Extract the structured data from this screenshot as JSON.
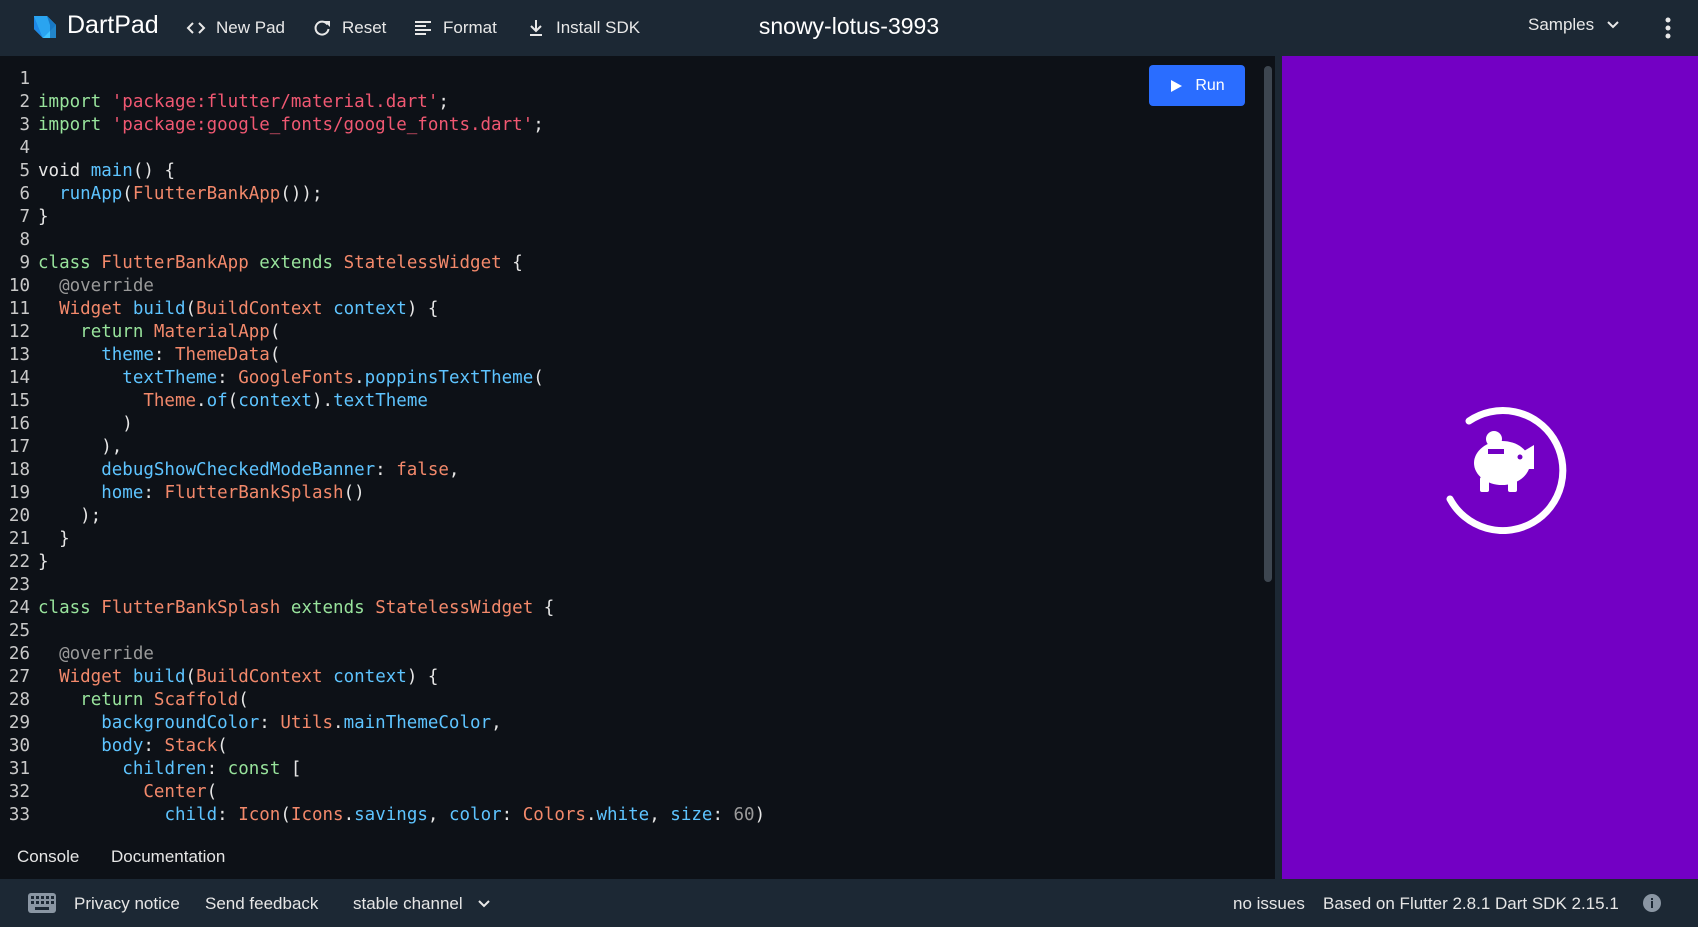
{
  "header": {
    "brand": "DartPad",
    "new_pad": "New Pad",
    "reset": "Reset",
    "format": "Format",
    "install_sdk": "Install SDK",
    "pad_name": "snowy-lotus-3993",
    "samples": "Samples"
  },
  "editor": {
    "run_label": "Run",
    "line_numbers": [
      "1",
      "2",
      "3",
      "4",
      "5",
      "6",
      "7",
      "8",
      "9",
      "10",
      "11",
      "12",
      "13",
      "14",
      "15",
      "16",
      "17",
      "18",
      "19",
      "20",
      "21",
      "22",
      "23",
      "24",
      "25",
      "26",
      "27",
      "28",
      "29",
      "30",
      "31",
      "32",
      "33"
    ],
    "lines": [
      [],
      [
        [
          "kw",
          "import"
        ],
        [
          "p",
          " "
        ],
        [
          "str",
          "'package:flutter/material.dart'"
        ],
        [
          "p",
          ";"
        ]
      ],
      [
        [
          "kw",
          "import"
        ],
        [
          "p",
          " "
        ],
        [
          "str",
          "'package:google_fonts/google_fonts.dart'"
        ],
        [
          "p",
          ";"
        ]
      ],
      [],
      [
        [
          "p",
          "void "
        ],
        [
          "fn",
          "main"
        ],
        [
          "p",
          "() {"
        ]
      ],
      [
        [
          "p",
          "  "
        ],
        [
          "fn",
          "runApp"
        ],
        [
          "p",
          "("
        ],
        [
          "type",
          "FlutterBankApp"
        ],
        [
          "p",
          "());"
        ]
      ],
      [
        [
          "p",
          "}"
        ]
      ],
      [],
      [
        [
          "kw",
          "class"
        ],
        [
          "p",
          " "
        ],
        [
          "type",
          "FlutterBankApp"
        ],
        [
          "p",
          " "
        ],
        [
          "kw",
          "extends"
        ],
        [
          "p",
          " "
        ],
        [
          "type",
          "StatelessWidget"
        ],
        [
          "p",
          " {"
        ]
      ],
      [
        [
          "p",
          "  "
        ],
        [
          "ann",
          "@override"
        ]
      ],
      [
        [
          "p",
          "  "
        ],
        [
          "type",
          "Widget"
        ],
        [
          "p",
          " "
        ],
        [
          "fn",
          "build"
        ],
        [
          "p",
          "("
        ],
        [
          "type",
          "BuildContext"
        ],
        [
          "p",
          " "
        ],
        [
          "prop",
          "context"
        ],
        [
          "p",
          ") {"
        ]
      ],
      [
        [
          "p",
          "    "
        ],
        [
          "kw",
          "return"
        ],
        [
          "p",
          " "
        ],
        [
          "type",
          "MaterialApp"
        ],
        [
          "p",
          "("
        ]
      ],
      [
        [
          "p",
          "      "
        ],
        [
          "prop",
          "theme"
        ],
        [
          "p",
          ": "
        ],
        [
          "type",
          "ThemeData"
        ],
        [
          "p",
          "("
        ]
      ],
      [
        [
          "p",
          "        "
        ],
        [
          "prop",
          "textTheme"
        ],
        [
          "p",
          ": "
        ],
        [
          "type",
          "GoogleFonts"
        ],
        [
          "p",
          "."
        ],
        [
          "fn",
          "poppinsTextTheme"
        ],
        [
          "p",
          "("
        ]
      ],
      [
        [
          "p",
          "          "
        ],
        [
          "type",
          "Theme"
        ],
        [
          "p",
          "."
        ],
        [
          "fn",
          "of"
        ],
        [
          "p",
          "("
        ],
        [
          "prop",
          "context"
        ],
        [
          "p",
          ")."
        ],
        [
          "prop",
          "textTheme"
        ]
      ],
      [
        [
          "p",
          "        )"
        ]
      ],
      [
        [
          "p",
          "      ),"
        ]
      ],
      [
        [
          "p",
          "      "
        ],
        [
          "prop",
          "debugShowCheckedModeBanner"
        ],
        [
          "p",
          ": "
        ],
        [
          "lit",
          "false"
        ],
        [
          "p",
          ","
        ]
      ],
      [
        [
          "p",
          "      "
        ],
        [
          "prop",
          "home"
        ],
        [
          "p",
          ": "
        ],
        [
          "type",
          "FlutterBankSplash"
        ],
        [
          "p",
          "()"
        ]
      ],
      [
        [
          "p",
          "    );"
        ]
      ],
      [
        [
          "p",
          "  }"
        ]
      ],
      [
        [
          "p",
          "}"
        ]
      ],
      [],
      [
        [
          "kw",
          "class"
        ],
        [
          "p",
          " "
        ],
        [
          "type",
          "FlutterBankSplash"
        ],
        [
          "p",
          " "
        ],
        [
          "kw",
          "extends"
        ],
        [
          "p",
          " "
        ],
        [
          "type",
          "StatelessWidget"
        ],
        [
          "p",
          " {"
        ]
      ],
      [],
      [
        [
          "p",
          "  "
        ],
        [
          "ann",
          "@override"
        ]
      ],
      [
        [
          "p",
          "  "
        ],
        [
          "type",
          "Widget"
        ],
        [
          "p",
          " "
        ],
        [
          "fn",
          "build"
        ],
        [
          "p",
          "("
        ],
        [
          "type",
          "BuildContext"
        ],
        [
          "p",
          " "
        ],
        [
          "prop",
          "context"
        ],
        [
          "p",
          ") {"
        ]
      ],
      [
        [
          "p",
          "    "
        ],
        [
          "kw",
          "return"
        ],
        [
          "p",
          " "
        ],
        [
          "type",
          "Scaffold"
        ],
        [
          "p",
          "("
        ]
      ],
      [
        [
          "p",
          "      "
        ],
        [
          "prop",
          "backgroundColor"
        ],
        [
          "p",
          ": "
        ],
        [
          "type",
          "Utils"
        ],
        [
          "p",
          "."
        ],
        [
          "prop",
          "mainThemeColor"
        ],
        [
          "p",
          ","
        ]
      ],
      [
        [
          "p",
          "      "
        ],
        [
          "prop",
          "body"
        ],
        [
          "p",
          ": "
        ],
        [
          "type",
          "Stack"
        ],
        [
          "p",
          "("
        ]
      ],
      [
        [
          "p",
          "        "
        ],
        [
          "prop",
          "children"
        ],
        [
          "p",
          ": "
        ],
        [
          "kw",
          "const"
        ],
        [
          "p",
          " ["
        ]
      ],
      [
        [
          "p",
          "          "
        ],
        [
          "type",
          "Center"
        ],
        [
          "p",
          "("
        ]
      ],
      [
        [
          "p",
          "            "
        ],
        [
          "prop",
          "child"
        ],
        [
          "p",
          ": "
        ],
        [
          "type",
          "Icon"
        ],
        [
          "p",
          "("
        ],
        [
          "type",
          "Icons"
        ],
        [
          "p",
          "."
        ],
        [
          "prop",
          "savings"
        ],
        [
          "p",
          ", "
        ],
        [
          "prop",
          "color"
        ],
        [
          "p",
          ": "
        ],
        [
          "type",
          "Colors"
        ],
        [
          "p",
          "."
        ],
        [
          "prop",
          "white"
        ],
        [
          "p",
          ", "
        ],
        [
          "prop",
          "size"
        ],
        [
          "p",
          ": "
        ],
        [
          "num",
          "60"
        ],
        [
          "p",
          ")"
        ]
      ]
    ]
  },
  "tabs": {
    "console": "Console",
    "documentation": "Documentation"
  },
  "footer": {
    "privacy": "Privacy notice",
    "feedback": "Send feedback",
    "channel": "stable channel",
    "issues": "no issues",
    "sdk_info": "Based on Flutter 2.8.1 Dart SDK 2.15.1"
  },
  "icons": {
    "logo": "dart-logo-icon",
    "new_pad": "code-brackets-icon",
    "reset": "refresh-icon",
    "format": "align-left-icon",
    "install_sdk": "download-icon",
    "samples": "chevron-down-icon",
    "more": "kebab-menu-icon",
    "run": "play-icon",
    "splash": "savings-icon",
    "keyboard": "keyboard-icon",
    "info": "info-icon"
  },
  "colors": {
    "topbar": "#1c2834",
    "editor_bg": "#0d1117",
    "run_button": "#2a6dff",
    "output_bg": "#7300c4"
  }
}
